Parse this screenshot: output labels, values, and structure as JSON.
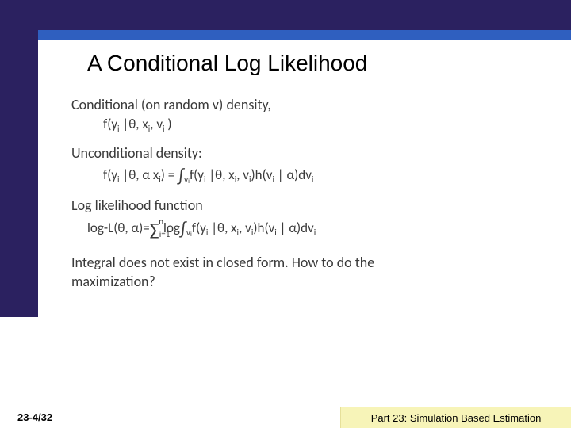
{
  "title": "A Conditional Log Likelihood",
  "lines": {
    "l1": "Conditional (on random v) density,",
    "eq1": "f(y",
    "eq1_sub": "i",
    "eq1_rest": " |θ, x",
    "eq1_sub2": "i",
    "eq1_rest2": ", v",
    "eq1_sub3": "i",
    "eq1_rest3": " )",
    "l2": "Unconditional density:",
    "eq2_l": "f(y",
    "eq2_sub1": "i",
    "eq2_m": " |θ, α  x",
    "eq2_sub2": "i",
    "eq2_r": ") = ",
    "eq2_intsub": "v",
    "eq2_intsub_i": "i",
    "eq2_fy": "f(y",
    "eq2_s3": "i",
    "eq2_m2": " |θ, x",
    "eq2_s4": "i",
    "eq2_m3": ", v",
    "eq2_s5": "i",
    "eq2_m4": ")h(v",
    "eq2_s6": "i",
    "eq2_m5": " | α)dv",
    "eq2_s7": "i",
    "l3": "Log likelihood function",
    "eq3_l": "log-L(θ, α)=",
    "eq3_sum_n": "n",
    "eq3_sum_i": "i=1",
    "eq3_log": "log",
    "eq3_intsub": "v",
    "eq3_intsub_i": "i",
    "eq3_fy": "f(y",
    "eq3_s3": "i",
    "eq3_m2": " |θ, x",
    "eq3_s4": "i",
    "eq3_m3": ", v",
    "eq3_s5": "i",
    "eq3_m4": ")h(v",
    "eq3_s6": "i",
    "eq3_m5": " | α)dv",
    "eq3_s7": "i",
    "l4a": "Integral does not exist in closed form.  How to do the",
    "l4b": "maximization?"
  },
  "footer": {
    "left": "23-4/32",
    "right": "Part 23: Simulation Based Estimation"
  }
}
